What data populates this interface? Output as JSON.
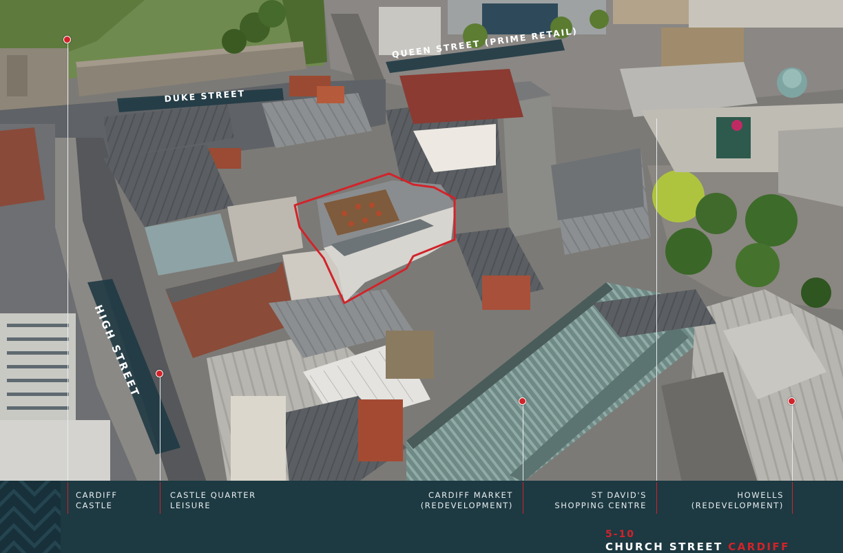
{
  "streets": {
    "queen_street": "QUEEN STREET (PRIME RETAIL)",
    "duke_street": "DUKE STREET",
    "high_street": "HIGH STREET"
  },
  "landmarks": [
    {
      "line1": "CARDIFF",
      "line2": "CASTLE"
    },
    {
      "line1": "CASTLE QUARTER",
      "line2": "LEISURE"
    },
    {
      "line1": "CARDIFF MARKET",
      "line2": "(REDEVELOPMENT)"
    },
    {
      "line1": "ST DAVID'S",
      "line2": "SHOPPING CENTRE"
    },
    {
      "line1": "HOWELLS",
      "line2": "(REDEVELOPMENT)"
    }
  ],
  "address": {
    "number": "5-10",
    "street": "CHURCH STREET",
    "city": "CARDIFF"
  },
  "colors": {
    "accent_red": "#d2232a",
    "footer_bg": "#1d3942",
    "label_text": "#e9eef0"
  },
  "icons": {
    "pattern": "chevron-pattern",
    "pin": "location-pin-dot"
  }
}
